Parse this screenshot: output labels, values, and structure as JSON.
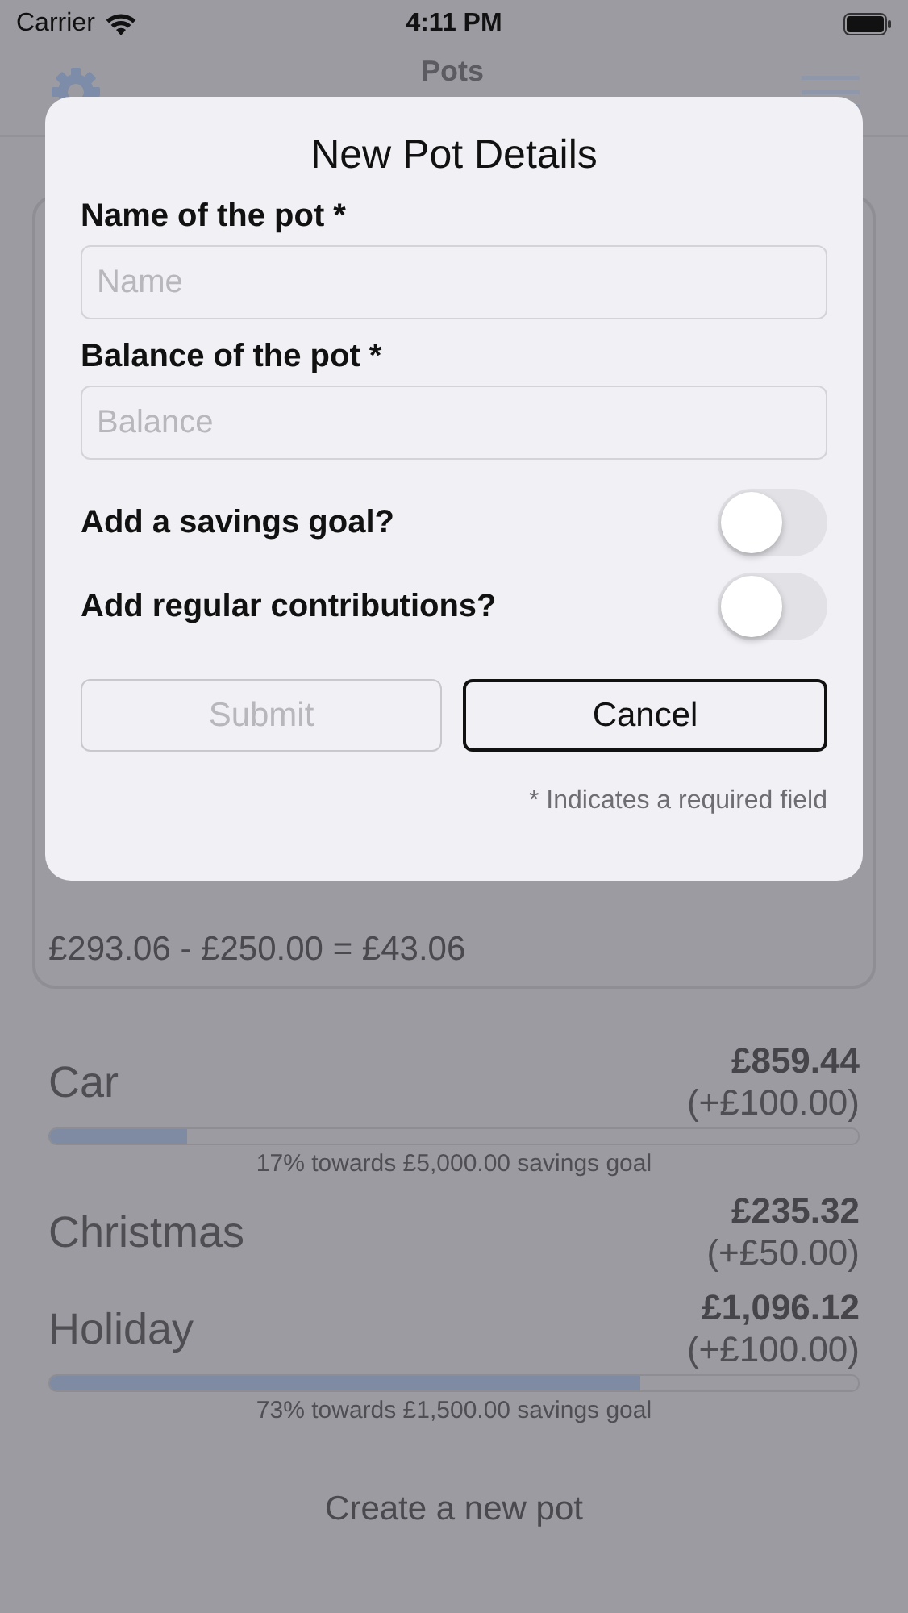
{
  "status_bar": {
    "carrier": "Carrier",
    "time": "4:11 PM"
  },
  "nav": {
    "title": "Pots"
  },
  "summary": {
    "calculation": "£293.06 - £250.00 = £43.06"
  },
  "pots": [
    {
      "name": "Car",
      "balance": "£859.44",
      "contribution": "(+£100.00)",
      "level": 0.17,
      "goal": "17% towards £5,000.00 savings goal"
    },
    {
      "name": "Christmas",
      "balance": "£235.32",
      "contribution": "(+£50.00)"
    },
    {
      "name": "Holiday",
      "balance": "£1,096.12",
      "contribution": "(+£100.00)",
      "level": 0.73,
      "goal": "73% towards £1,500.00 savings goal"
    }
  ],
  "create_button": "Create a new pot",
  "dialog": {
    "title": "New Pot Details",
    "fields": [
      {
        "label": "Name of the pot *",
        "placeholder": "Name"
      },
      {
        "label": "Balance of the pot *",
        "placeholder": "Balance"
      }
    ],
    "toggles": [
      {
        "label": "Add a savings goal?",
        "on": false
      },
      {
        "label": "Add regular contributions?",
        "on": false
      }
    ],
    "buttons": [
      {
        "label": "Submit",
        "disabled": true
      },
      {
        "label": "Cancel",
        "disabled": false
      }
    ],
    "note": "* Indicates a required field"
  }
}
